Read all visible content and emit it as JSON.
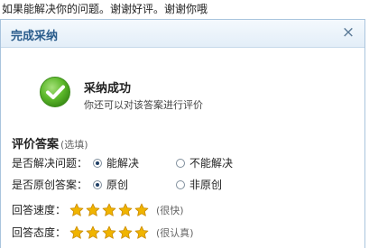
{
  "top_text": "如果能解决你的问题。谢谢好评。谢谢你哦",
  "dialog": {
    "title": "完成采纳",
    "close_glyph": "×"
  },
  "success": {
    "title": "采纳成功",
    "subtitle": "你还可以对该答案进行评价"
  },
  "evaluation": {
    "title": "评价答案",
    "optional": "(选填)",
    "questions": [
      {
        "label": "是否解决问题：",
        "options": [
          "能解决",
          "不能解决"
        ],
        "selected": "能解决"
      },
      {
        "label": "是否原创答案：",
        "options": [
          "原创",
          "非原创"
        ],
        "selected": "原创"
      }
    ],
    "ratings": [
      {
        "label": "回答速度：",
        "stars": 5,
        "max_stars": 5,
        "note": "(很快)"
      },
      {
        "label": "回答态度：",
        "stars": 5,
        "max_stars": 5,
        "note": "(很认真)"
      }
    ]
  },
  "colors": {
    "accent": "#2b5d8c",
    "success_green": "#5cb82a",
    "star_gold": "#f0b400"
  }
}
